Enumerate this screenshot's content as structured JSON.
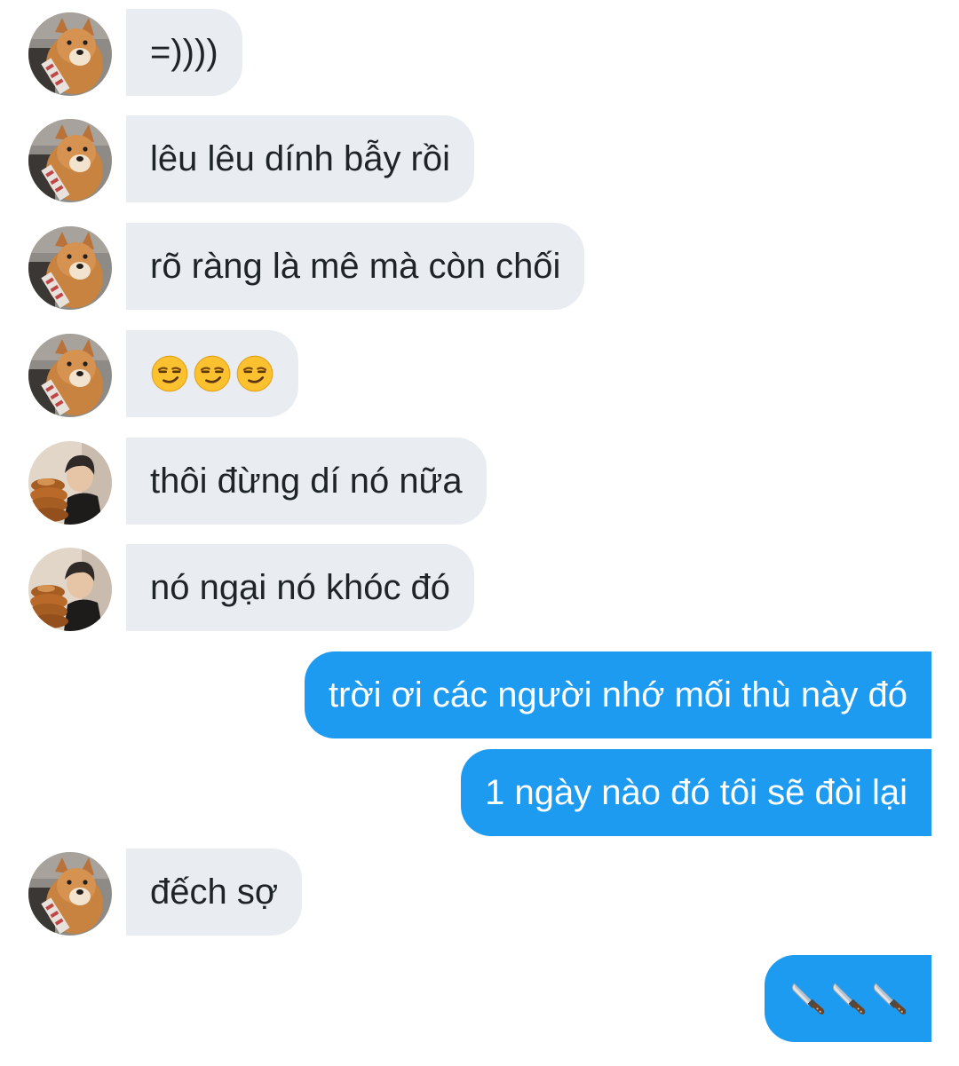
{
  "messages": [
    {
      "text": "=))))",
      "sender": "shiba"
    },
    {
      "text": "lêu lêu dính bẫy rồi",
      "sender": "shiba"
    },
    {
      "text": "rõ ràng là mê mà còn chối",
      "sender": "shiba"
    },
    {
      "emoji": [
        "smirking-face",
        "smirking-face",
        "smirking-face"
      ],
      "sender": "shiba"
    },
    {
      "text": "thôi đừng dí nó nữa",
      "sender": "person"
    },
    {
      "text": "nó ngại nó khóc đó",
      "sender": "person"
    },
    {
      "text": "trời ơi các người nhớ mối thù này đó",
      "sender": "me"
    },
    {
      "text": "1 ngày nào đó tôi sẽ đòi lại",
      "sender": "me"
    },
    {
      "text": "đếch sợ",
      "sender": "shiba"
    },
    {
      "emoji": [
        "kitchen-knife",
        "kitchen-knife",
        "kitchen-knife"
      ],
      "sender": "me"
    }
  ],
  "colors": {
    "incoming_bubble": "#e9edf1",
    "incoming_text": "#1f2428",
    "outgoing_bubble": "#1d9bf0",
    "outgoing_text": "#ffffff"
  }
}
